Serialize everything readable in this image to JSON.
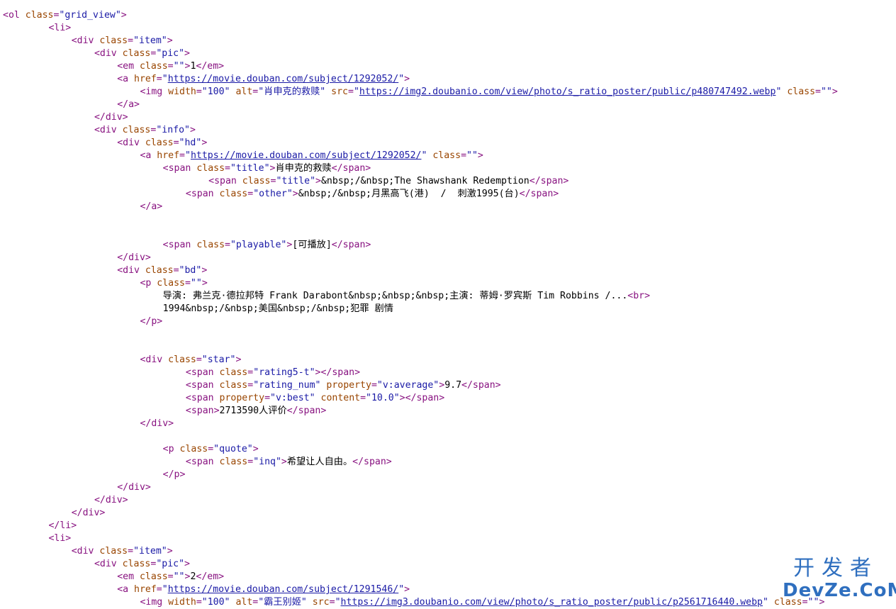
{
  "source_lines": [
    {
      "indent": 0,
      "parts": [
        [
          "t",
          "<ol "
        ],
        [
          "a",
          "class"
        ],
        [
          "t",
          "="
        ],
        [
          "v",
          "\"grid_view\""
        ],
        [
          "t",
          ">"
        ]
      ]
    },
    {
      "indent": 8,
      "parts": [
        [
          "t",
          "<li>"
        ]
      ]
    },
    {
      "indent": 12,
      "parts": [
        [
          "t",
          "<div "
        ],
        [
          "a",
          "class"
        ],
        [
          "t",
          "="
        ],
        [
          "v",
          "\"item\""
        ],
        [
          "t",
          ">"
        ]
      ]
    },
    {
      "indent": 16,
      "parts": [
        [
          "t",
          "<div "
        ],
        [
          "a",
          "class"
        ],
        [
          "t",
          "="
        ],
        [
          "v",
          "\"pic\""
        ],
        [
          "t",
          ">"
        ]
      ]
    },
    {
      "indent": 20,
      "parts": [
        [
          "t",
          "<em "
        ],
        [
          "a",
          "class"
        ],
        [
          "t",
          "="
        ],
        [
          "v",
          "\"\""
        ],
        [
          "t",
          ">"
        ],
        [
          "x",
          "1"
        ],
        [
          "t",
          "</em>"
        ]
      ]
    },
    {
      "indent": 20,
      "parts": [
        [
          "t",
          "<a "
        ],
        [
          "a",
          "href"
        ],
        [
          "t",
          "="
        ],
        [
          "v",
          "\""
        ],
        [
          "l",
          "https://movie.douban.com/subject/1292052/"
        ],
        [
          "v",
          "\""
        ],
        [
          "t",
          ">"
        ]
      ]
    },
    {
      "indent": 24,
      "parts": [
        [
          "t",
          "<img "
        ],
        [
          "a",
          "width"
        ],
        [
          "t",
          "="
        ],
        [
          "v",
          "\"100\" "
        ],
        [
          "a",
          "alt"
        ],
        [
          "t",
          "="
        ],
        [
          "v",
          "\"肖申克的救赎\" "
        ],
        [
          "a",
          "src"
        ],
        [
          "t",
          "="
        ],
        [
          "v",
          "\""
        ],
        [
          "l",
          "https://img2.doubanio.com/view/photo/s_ratio_poster/public/p480747492.webp"
        ],
        [
          "v",
          "\" "
        ],
        [
          "a",
          "class"
        ],
        [
          "t",
          "="
        ],
        [
          "v",
          "\"\""
        ],
        [
          "t",
          ">"
        ]
      ]
    },
    {
      "indent": 20,
      "parts": [
        [
          "t",
          "</a>"
        ]
      ]
    },
    {
      "indent": 16,
      "parts": [
        [
          "t",
          "</div>"
        ]
      ]
    },
    {
      "indent": 16,
      "parts": [
        [
          "t",
          "<div "
        ],
        [
          "a",
          "class"
        ],
        [
          "t",
          "="
        ],
        [
          "v",
          "\"info\""
        ],
        [
          "t",
          ">"
        ]
      ]
    },
    {
      "indent": 20,
      "parts": [
        [
          "t",
          "<div "
        ],
        [
          "a",
          "class"
        ],
        [
          "t",
          "="
        ],
        [
          "v",
          "\"hd\""
        ],
        [
          "t",
          ">"
        ]
      ]
    },
    {
      "indent": 24,
      "parts": [
        [
          "t",
          "<a "
        ],
        [
          "a",
          "href"
        ],
        [
          "t",
          "="
        ],
        [
          "v",
          "\""
        ],
        [
          "l",
          "https://movie.douban.com/subject/1292052/"
        ],
        [
          "v",
          "\" "
        ],
        [
          "a",
          "class"
        ],
        [
          "t",
          "="
        ],
        [
          "v",
          "\"\""
        ],
        [
          "t",
          ">"
        ]
      ]
    },
    {
      "indent": 28,
      "parts": [
        [
          "t",
          "<span "
        ],
        [
          "a",
          "class"
        ],
        [
          "t",
          "="
        ],
        [
          "v",
          "\"title\""
        ],
        [
          "t",
          ">"
        ],
        [
          "x",
          "肖申克的救赎"
        ],
        [
          "t",
          "</span>"
        ]
      ]
    },
    {
      "indent": 36,
      "parts": [
        [
          "t",
          "<span "
        ],
        [
          "a",
          "class"
        ],
        [
          "t",
          "="
        ],
        [
          "v",
          "\"title\""
        ],
        [
          "t",
          ">"
        ],
        [
          "x",
          "&nbsp;/&nbsp;The Shawshank Redemption"
        ],
        [
          "t",
          "</span>"
        ]
      ]
    },
    {
      "indent": 32,
      "parts": [
        [
          "t",
          "<span "
        ],
        [
          "a",
          "class"
        ],
        [
          "t",
          "="
        ],
        [
          "v",
          "\"other\""
        ],
        [
          "t",
          ">"
        ],
        [
          "x",
          "&nbsp;/&nbsp;月黑高飞(港)  /  刺激1995(台)"
        ],
        [
          "t",
          "</span>"
        ]
      ]
    },
    {
      "indent": 24,
      "parts": [
        [
          "t",
          "</a>"
        ]
      ]
    },
    {
      "indent": 0,
      "parts": []
    },
    {
      "indent": 0,
      "parts": []
    },
    {
      "indent": 28,
      "parts": [
        [
          "t",
          "<span "
        ],
        [
          "a",
          "class"
        ],
        [
          "t",
          "="
        ],
        [
          "v",
          "\"playable\""
        ],
        [
          "t",
          ">"
        ],
        [
          "x",
          "[可播放]"
        ],
        [
          "t",
          "</span>"
        ]
      ]
    },
    {
      "indent": 20,
      "parts": [
        [
          "t",
          "</div>"
        ]
      ]
    },
    {
      "indent": 20,
      "parts": [
        [
          "t",
          "<div "
        ],
        [
          "a",
          "class"
        ],
        [
          "t",
          "="
        ],
        [
          "v",
          "\"bd\""
        ],
        [
          "t",
          ">"
        ]
      ]
    },
    {
      "indent": 24,
      "parts": [
        [
          "t",
          "<p "
        ],
        [
          "a",
          "class"
        ],
        [
          "t",
          "="
        ],
        [
          "v",
          "\"\""
        ],
        [
          "t",
          ">"
        ]
      ]
    },
    {
      "indent": 28,
      "parts": [
        [
          "x",
          "导演: 弗兰克·德拉邦特 Frank Darabont&nbsp;&nbsp;&nbsp;主演: 蒂姆·罗宾斯 Tim Robbins /..."
        ],
        [
          "t",
          "<br>"
        ]
      ]
    },
    {
      "indent": 28,
      "parts": [
        [
          "x",
          "1994&nbsp;/&nbsp;美国&nbsp;/&nbsp;犯罪 剧情"
        ]
      ]
    },
    {
      "indent": 24,
      "parts": [
        [
          "t",
          "</p>"
        ]
      ]
    },
    {
      "indent": 0,
      "parts": []
    },
    {
      "indent": 0,
      "parts": []
    },
    {
      "indent": 24,
      "parts": [
        [
          "t",
          "<div "
        ],
        [
          "a",
          "class"
        ],
        [
          "t",
          "="
        ],
        [
          "v",
          "\"star\""
        ],
        [
          "t",
          ">"
        ]
      ]
    },
    {
      "indent": 32,
      "parts": [
        [
          "t",
          "<span "
        ],
        [
          "a",
          "class"
        ],
        [
          "t",
          "="
        ],
        [
          "v",
          "\"rating5-t\""
        ],
        [
          "t",
          "></span>"
        ]
      ]
    },
    {
      "indent": 32,
      "parts": [
        [
          "t",
          "<span "
        ],
        [
          "a",
          "class"
        ],
        [
          "t",
          "="
        ],
        [
          "v",
          "\"rating_num\" "
        ],
        [
          "a",
          "property"
        ],
        [
          "t",
          "="
        ],
        [
          "v",
          "\"v:average\""
        ],
        [
          "t",
          ">"
        ],
        [
          "x",
          "9.7"
        ],
        [
          "t",
          "</span>"
        ]
      ]
    },
    {
      "indent": 32,
      "parts": [
        [
          "t",
          "<span "
        ],
        [
          "a",
          "property"
        ],
        [
          "t",
          "="
        ],
        [
          "v",
          "\"v:best\" "
        ],
        [
          "a",
          "content"
        ],
        [
          "t",
          "="
        ],
        [
          "v",
          "\"10.0\""
        ],
        [
          "t",
          "></span>"
        ]
      ]
    },
    {
      "indent": 32,
      "parts": [
        [
          "t",
          "<span>"
        ],
        [
          "x",
          "2713590人评价"
        ],
        [
          "t",
          "</span>"
        ]
      ]
    },
    {
      "indent": 24,
      "parts": [
        [
          "t",
          "</div>"
        ]
      ]
    },
    {
      "indent": 0,
      "parts": []
    },
    {
      "indent": 28,
      "parts": [
        [
          "t",
          "<p "
        ],
        [
          "a",
          "class"
        ],
        [
          "t",
          "="
        ],
        [
          "v",
          "\"quote\""
        ],
        [
          "t",
          ">"
        ]
      ]
    },
    {
      "indent": 32,
      "parts": [
        [
          "t",
          "<span "
        ],
        [
          "a",
          "class"
        ],
        [
          "t",
          "="
        ],
        [
          "v",
          "\"inq\""
        ],
        [
          "t",
          ">"
        ],
        [
          "x",
          "希望让人自由。"
        ],
        [
          "t",
          "</span>"
        ]
      ]
    },
    {
      "indent": 28,
      "parts": [
        [
          "t",
          "</p>"
        ]
      ]
    },
    {
      "indent": 20,
      "parts": [
        [
          "t",
          "</div>"
        ]
      ]
    },
    {
      "indent": 16,
      "parts": [
        [
          "t",
          "</div>"
        ]
      ]
    },
    {
      "indent": 12,
      "parts": [
        [
          "t",
          "</div>"
        ]
      ]
    },
    {
      "indent": 8,
      "parts": [
        [
          "t",
          "</li>"
        ]
      ]
    },
    {
      "indent": 8,
      "parts": [
        [
          "t",
          "<li>"
        ]
      ]
    },
    {
      "indent": 12,
      "parts": [
        [
          "t",
          "<div "
        ],
        [
          "a",
          "class"
        ],
        [
          "t",
          "="
        ],
        [
          "v",
          "\"item\""
        ],
        [
          "t",
          ">"
        ]
      ]
    },
    {
      "indent": 16,
      "parts": [
        [
          "t",
          "<div "
        ],
        [
          "a",
          "class"
        ],
        [
          "t",
          "="
        ],
        [
          "v",
          "\"pic\""
        ],
        [
          "t",
          ">"
        ]
      ]
    },
    {
      "indent": 20,
      "parts": [
        [
          "t",
          "<em "
        ],
        [
          "a",
          "class"
        ],
        [
          "t",
          "="
        ],
        [
          "v",
          "\"\""
        ],
        [
          "t",
          ">"
        ],
        [
          "x",
          "2"
        ],
        [
          "t",
          "</em>"
        ]
      ]
    },
    {
      "indent": 20,
      "parts": [
        [
          "t",
          "<a "
        ],
        [
          "a",
          "href"
        ],
        [
          "t",
          "="
        ],
        [
          "v",
          "\""
        ],
        [
          "l",
          "https://movie.douban.com/subject/1291546/"
        ],
        [
          "v",
          "\""
        ],
        [
          "t",
          ">"
        ]
      ]
    },
    {
      "indent": 24,
      "parts": [
        [
          "t",
          "<img "
        ],
        [
          "a",
          "width"
        ],
        [
          "t",
          "="
        ],
        [
          "v",
          "\"100\" "
        ],
        [
          "a",
          "alt"
        ],
        [
          "t",
          "="
        ],
        [
          "v",
          "\"霸王别姬\" "
        ],
        [
          "a",
          "src"
        ],
        [
          "t",
          "="
        ],
        [
          "v",
          "\""
        ],
        [
          "l",
          "https://img3.doubanio.com/view/photo/s_ratio_poster/public/p2561716440.webp"
        ],
        [
          "v",
          "\" "
        ],
        [
          "a",
          "class"
        ],
        [
          "t",
          "="
        ],
        [
          "v",
          "\"\""
        ],
        [
          "t",
          ">"
        ]
      ]
    }
  ],
  "colors": {
    "tag": "#881280",
    "attr_name": "#994500",
    "attr_value": "#1a1aa6",
    "text": "#000000",
    "watermark": "#2f6fbf"
  },
  "watermark": {
    "cn": "开发者",
    "en": "DevZe.CoM"
  }
}
